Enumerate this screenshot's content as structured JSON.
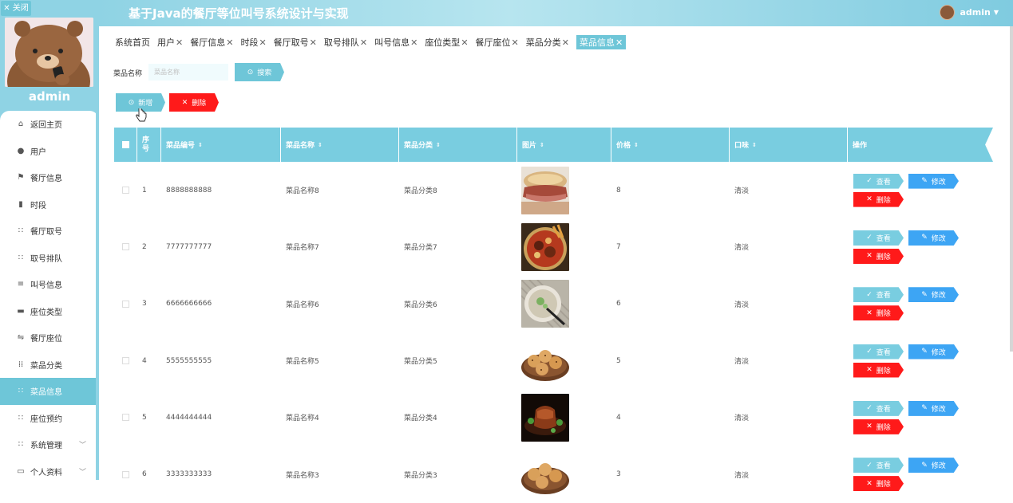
{
  "header": {
    "title": "基于Java的餐厅等位叫号系统设计与实现",
    "user": "admin"
  },
  "sidebar": {
    "close_label": "关闭",
    "username": "admin",
    "items": [
      {
        "label": "返回主页",
        "icon": "home-icon"
      },
      {
        "label": "用户",
        "icon": "user-icon"
      },
      {
        "label": "餐厅信息",
        "icon": "flag-icon"
      },
      {
        "label": "时段",
        "icon": "bar-chart-icon"
      },
      {
        "label": "餐厅取号",
        "icon": "grid-icon"
      },
      {
        "label": "取号排队",
        "icon": "grid-icon"
      },
      {
        "label": "叫号信息",
        "icon": "list-icon"
      },
      {
        "label": "座位类型",
        "icon": "chat-icon"
      },
      {
        "label": "餐厅座位",
        "icon": "sliders-icon"
      },
      {
        "label": "菜品分类",
        "icon": "grid-dots-icon"
      },
      {
        "label": "菜品信息",
        "icon": "grid-icon",
        "active": true
      },
      {
        "label": "座位预约",
        "icon": "grid-icon"
      },
      {
        "label": "系统管理",
        "icon": "grid-icon",
        "has_children": true
      },
      {
        "label": "个人资料",
        "icon": "card-icon",
        "has_children": true
      }
    ]
  },
  "tabs": [
    {
      "label": "系统首页",
      "closable": false
    },
    {
      "label": "用户",
      "closable": true
    },
    {
      "label": "餐厅信息",
      "closable": true
    },
    {
      "label": "时段",
      "closable": true
    },
    {
      "label": "餐厅取号",
      "closable": true
    },
    {
      "label": "取号排队",
      "closable": true
    },
    {
      "label": "叫号信息",
      "closable": true
    },
    {
      "label": "座位类型",
      "closable": true
    },
    {
      "label": "餐厅座位",
      "closable": true
    },
    {
      "label": "菜品分类",
      "closable": true
    },
    {
      "label": "菜品信息",
      "closable": true,
      "active": true
    }
  ],
  "search": {
    "label": "菜品名称",
    "placeholder": "菜品名称",
    "button": "搜索"
  },
  "actions": {
    "add": "新增",
    "delete": "删除"
  },
  "table": {
    "headers": [
      "序号",
      "菜品编号",
      "菜品名称",
      "菜品分类",
      "图片",
      "价格",
      "口味",
      "操作"
    ],
    "rows": [
      {
        "index": "1",
        "code": "8888888888",
        "name": "菜品名称8",
        "category": "菜品分类8",
        "image": "sandwich",
        "price": "8",
        "taste": "清淡"
      },
      {
        "index": "2",
        "code": "7777777777",
        "name": "菜品名称7",
        "category": "菜品分类7",
        "image": "stew",
        "price": "7",
        "taste": "清淡"
      },
      {
        "index": "3",
        "code": "6666666666",
        "name": "菜品名称6",
        "category": "菜品分类6",
        "image": "soup",
        "price": "6",
        "taste": "清淡"
      },
      {
        "index": "4",
        "code": "5555555555",
        "name": "菜品名称5",
        "category": "菜品分类5",
        "image": "pastries",
        "price": "5",
        "taste": "清淡"
      },
      {
        "index": "5",
        "code": "4444444444",
        "name": "菜品名称4",
        "category": "菜品分类4",
        "image": "braised-pork",
        "price": "4",
        "taste": "清淡"
      },
      {
        "index": "6",
        "code": "3333333333",
        "name": "菜品名称3",
        "category": "菜品分类3",
        "image": "pastries",
        "price": "3",
        "taste": "清淡"
      }
    ],
    "row_actions": {
      "view": "查看",
      "edit": "修改",
      "delete": "删除"
    }
  },
  "colors": {
    "accent": "#6ec6d8",
    "danger": "#ff1a1a",
    "edit": "#3da5f4"
  }
}
